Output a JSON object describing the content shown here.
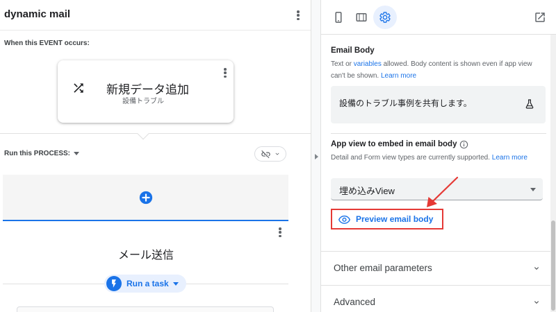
{
  "header": {
    "title": "dynamic mail"
  },
  "event": {
    "section_label": "When this EVENT occurs:",
    "name": "新規データ追加",
    "table": "設備トラブル",
    "icon": "shuffle-icon"
  },
  "process": {
    "section_label": "Run this PROCESS:",
    "link_icon": "unlink-icon",
    "add_icon": "add-circle-icon"
  },
  "step": {
    "title": "メール送信",
    "action_label": "Run a task",
    "action_icon": "bolt-icon"
  },
  "tabs": [
    {
      "name": "phone-icon",
      "active": false
    },
    {
      "name": "tablet-icon",
      "active": false
    },
    {
      "name": "gear-icon",
      "active": true
    }
  ],
  "email_body": {
    "title": "Email Body",
    "help_pre": "Text or ",
    "help_link": "variables",
    "help_post": " allowed. Body content is shown even if app view can't be shown. ",
    "learn_more": "Learn more",
    "value": "設備のトラブル事例を共有します。",
    "flask_icon": "flask-icon"
  },
  "embed": {
    "title": "App view to embed in email body",
    "help": "Detail and Form view types are currently supported. ",
    "learn_more": "Learn more",
    "selected_value": "埋め込みView"
  },
  "preview": {
    "label": "Preview email body",
    "icon": "eye-icon"
  },
  "accordions": [
    {
      "label": "Other email parameters"
    },
    {
      "label": "Advanced"
    }
  ],
  "colors": {
    "accent": "#1a73e8",
    "highlight": "#e53935",
    "add_bar_border": "#1a73e8"
  }
}
